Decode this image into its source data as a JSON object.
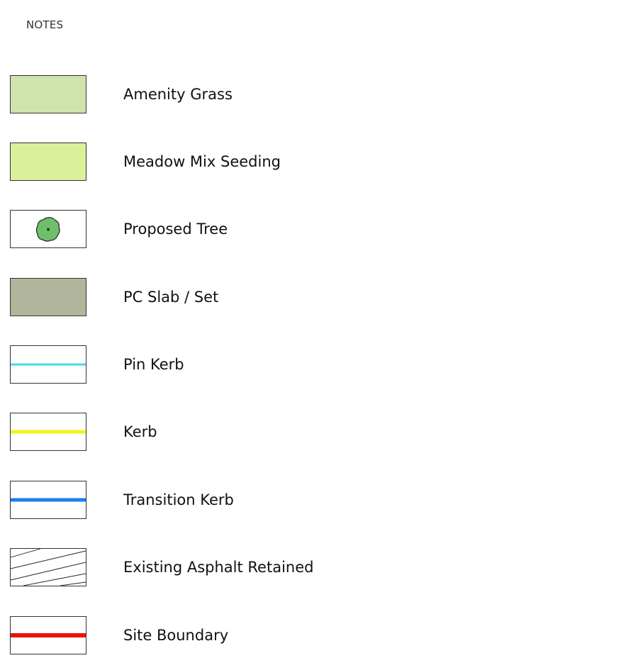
{
  "notes_title": "NOTES",
  "legend": [
    {
      "label": "Amenity Grass",
      "icon": "amenity-grass-swatch",
      "fill": "#cfe3ad"
    },
    {
      "label": "Meadow Mix Seeding",
      "icon": "meadow-mix-swatch",
      "fill": "#dcef9a"
    },
    {
      "label": "Proposed Tree",
      "icon": "tree-icon",
      "fill": "#6fbf6a"
    },
    {
      "label": "PC Slab / Set",
      "icon": "pc-slab-swatch",
      "fill": "#b1b59b"
    },
    {
      "label": "Pin Kerb",
      "icon": "pin-kerb-line",
      "line_color": "#39e0ea"
    },
    {
      "label": "Kerb",
      "icon": "kerb-line",
      "line_color": "#f3f31a"
    },
    {
      "label": "Transition Kerb",
      "icon": "transition-kerb-line",
      "line_color": "#1a7ef0"
    },
    {
      "label": "Existing Asphalt Retained",
      "icon": "hatch-swatch"
    },
    {
      "label": "Site Boundary",
      "icon": "site-boundary-line",
      "line_color": "#f00e0e"
    }
  ]
}
